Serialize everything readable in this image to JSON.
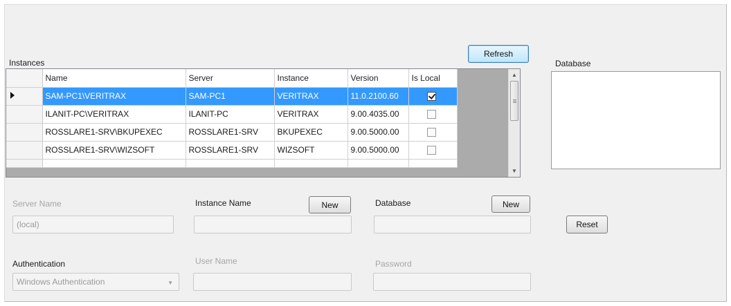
{
  "instances": {
    "label": "Instances",
    "refresh_label": "Refresh",
    "columns": [
      "Name",
      "Server",
      "Instance",
      "Version",
      "Is Local"
    ],
    "rows": [
      {
        "name": "SAM-PC1\\VERITRAX",
        "server": "SAM-PC1",
        "instance": "VERITRAX",
        "version": "11.0.2100.60",
        "is_local": true,
        "selected": true
      },
      {
        "name": "ILANIT-PC\\VERITRAX",
        "server": "ILANIT-PC",
        "instance": "VERITRAX",
        "version": "9.00.4035.00",
        "is_local": false
      },
      {
        "name": "ROSSLARE1-SRV\\BKUPEXEC",
        "server": "ROSSLARE1-SRV",
        "instance": "BKUPEXEC",
        "version": "9.00.5000.00",
        "is_local": false
      },
      {
        "name": "ROSSLARE1-SRV\\WIZSOFT",
        "server": "ROSSLARE1-SRV",
        "instance": "WIZSOFT",
        "version": "9.00.5000.00",
        "is_local": false
      }
    ]
  },
  "database_list": {
    "label": "Database"
  },
  "form": {
    "server_name_label": "Server Name",
    "server_name_value": "(local)",
    "instance_name_label": "Instance Name",
    "instance_new_label": "New",
    "database_label": "Database",
    "database_new_label": "New",
    "reset_label": "Reset",
    "authentication_label": "Authentication",
    "authentication_value": "Windows Authentication",
    "user_name_label": "User Name",
    "password_label": "Password"
  },
  "icons": {
    "row_pointer": "row-pointer-icon",
    "scroll_up": "scroll-up-icon",
    "scroll_down": "scroll-down-icon",
    "dropdown": "chevron-down-icon"
  }
}
